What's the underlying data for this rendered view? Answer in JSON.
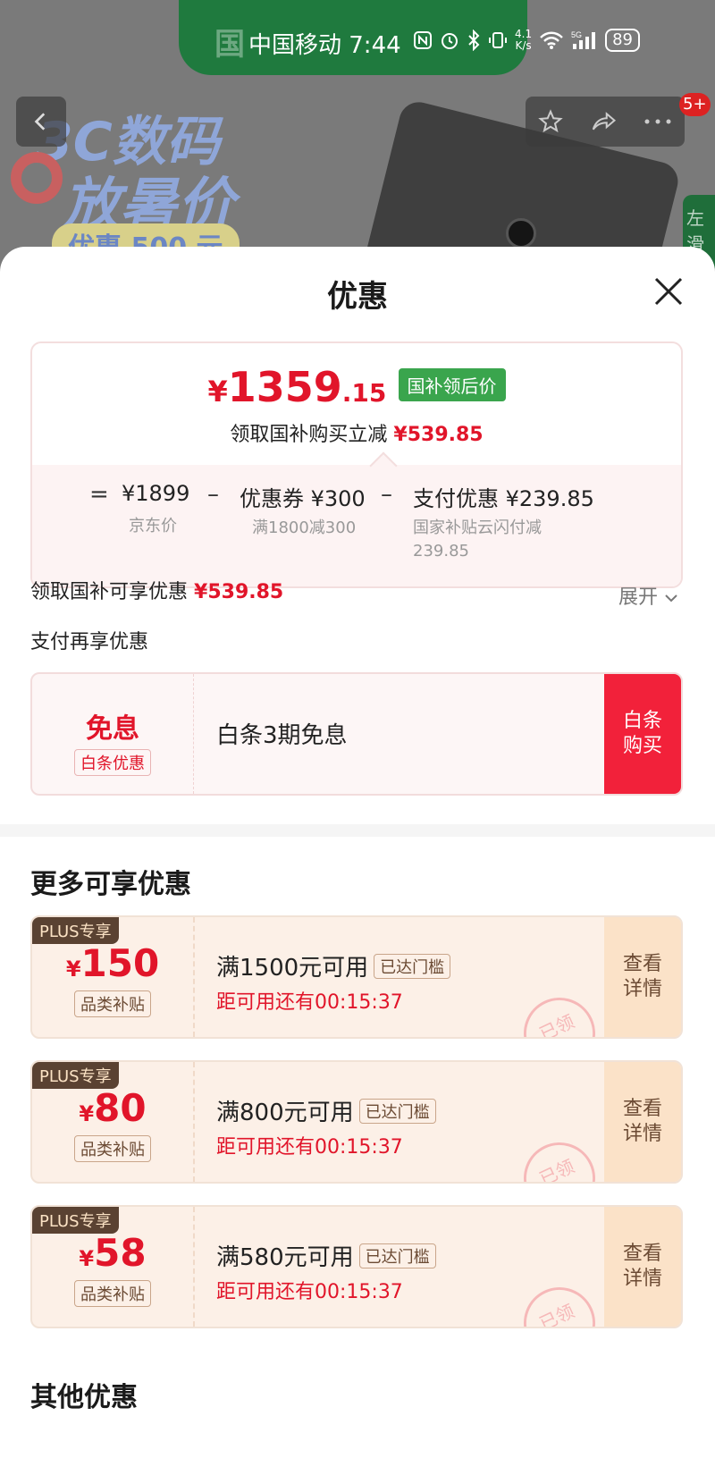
{
  "status_bar": {
    "carrier_time": "中国移动 7:44",
    "speed": "4.1\nK/s",
    "network": "5G",
    "battery": "89"
  },
  "background": {
    "banner_top": "国",
    "promo_line1": "3C数码",
    "promo_line2": "放暑价",
    "promo_line3": "优惠 500 元",
    "side_tab": "左滑",
    "cart_badge": "5+"
  },
  "sheet": {
    "title": "优惠",
    "price": {
      "yen": "¥",
      "integer": "1359",
      "decimal": ".15",
      "tag": "国补领后价",
      "sub_label": "领取国补购买立减",
      "sub_amount": "¥539.85"
    },
    "breakdown": {
      "eq": "=",
      "minus": "–",
      "jd_price": "¥1899",
      "jd_price_label": "京东价",
      "coupon": "优惠券 ¥300",
      "coupon_note": "满1800减300",
      "payment": "支付优惠 ¥239.85",
      "payment_note_1": "国家补贴云闪付减",
      "payment_note_2": "239.85"
    },
    "subsidy_row": {
      "label": "领取国补可享优惠",
      "amount": "¥539.85",
      "expand": "展开"
    },
    "pay_section": {
      "label": "支付再享优惠",
      "badge_big": "免息",
      "badge_small": "白条优惠",
      "text": "白条3期免息",
      "button_1": "白条",
      "button_2": "购买"
    },
    "more_title": "更多可享优惠",
    "coupons": [
      {
        "plus": "PLUS专享",
        "yen": "¥",
        "value": "150",
        "category": "品类补贴",
        "condition": "满1500元可用",
        "reached": "已达门槛",
        "timer": "距可用还有00:15:37",
        "detail_1": "查看",
        "detail_2": "详情",
        "stamp": "已领"
      },
      {
        "plus": "PLUS专享",
        "yen": "¥",
        "value": "80",
        "category": "品类补贴",
        "condition": "满800元可用",
        "reached": "已达门槛",
        "timer": "距可用还有00:15:37",
        "detail_1": "查看",
        "detail_2": "详情",
        "stamp": "已领"
      },
      {
        "plus": "PLUS专享",
        "yen": "¥",
        "value": "58",
        "category": "品类补贴",
        "condition": "满580元可用",
        "reached": "已达门槛",
        "timer": "距可用还有00:15:37",
        "detail_1": "查看",
        "detail_2": "详情",
        "stamp": "已领"
      }
    ],
    "other_title": "其他优惠"
  },
  "colors": {
    "accent_red": "#e1152a",
    "tag_green": "#3aa54d",
    "plus_brown": "#5a4232"
  }
}
